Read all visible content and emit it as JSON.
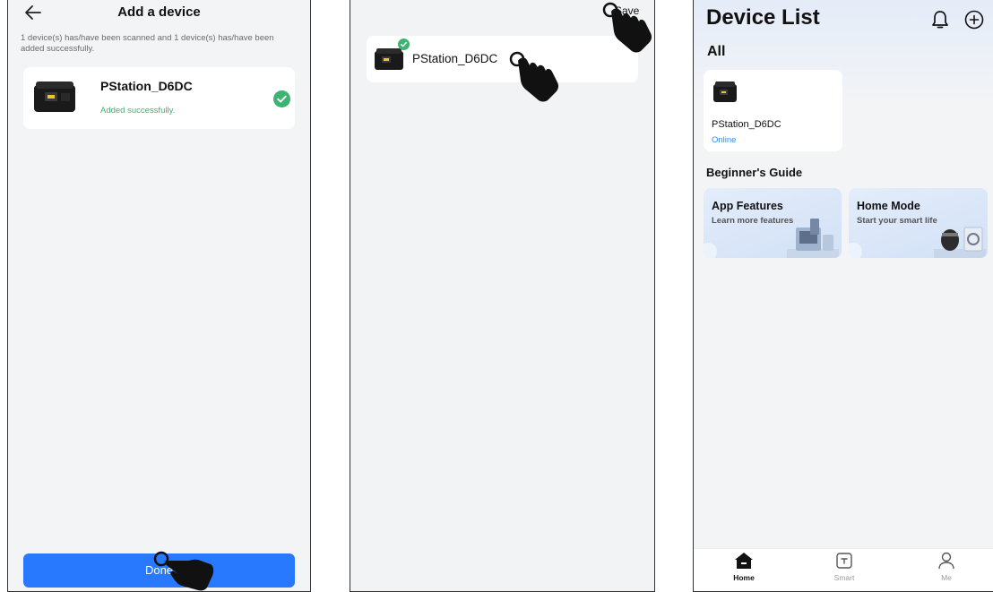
{
  "panel1": {
    "title": "Add a device",
    "description": "1 device(s) has/have been scanned and 1 device(s) has/have been added successfully.",
    "device": {
      "name": "PStation_D6DC",
      "status": "Added successfully."
    },
    "done_label": "Done"
  },
  "panel2": {
    "save_label": "Save",
    "device": {
      "name": "PStation_D6DC"
    }
  },
  "panel3": {
    "title": "Device List",
    "filter_tab": "All",
    "device": {
      "name": "PStation_D6DC",
      "status": "Online"
    },
    "guide_heading": "Beginner's Guide",
    "guides": [
      {
        "title": "App Features",
        "subtitle": "Learn more features"
      },
      {
        "title": "Home Mode",
        "subtitle": "Start your smart life"
      }
    ],
    "tabs": [
      {
        "label": "Home",
        "icon": "home-icon"
      },
      {
        "label": "Smart",
        "icon": "smart-icon"
      },
      {
        "label": "Me",
        "icon": "person-icon"
      }
    ]
  },
  "colors": {
    "accent": "#2979ff",
    "success": "#3cb371",
    "online": "#2f8cf5"
  }
}
